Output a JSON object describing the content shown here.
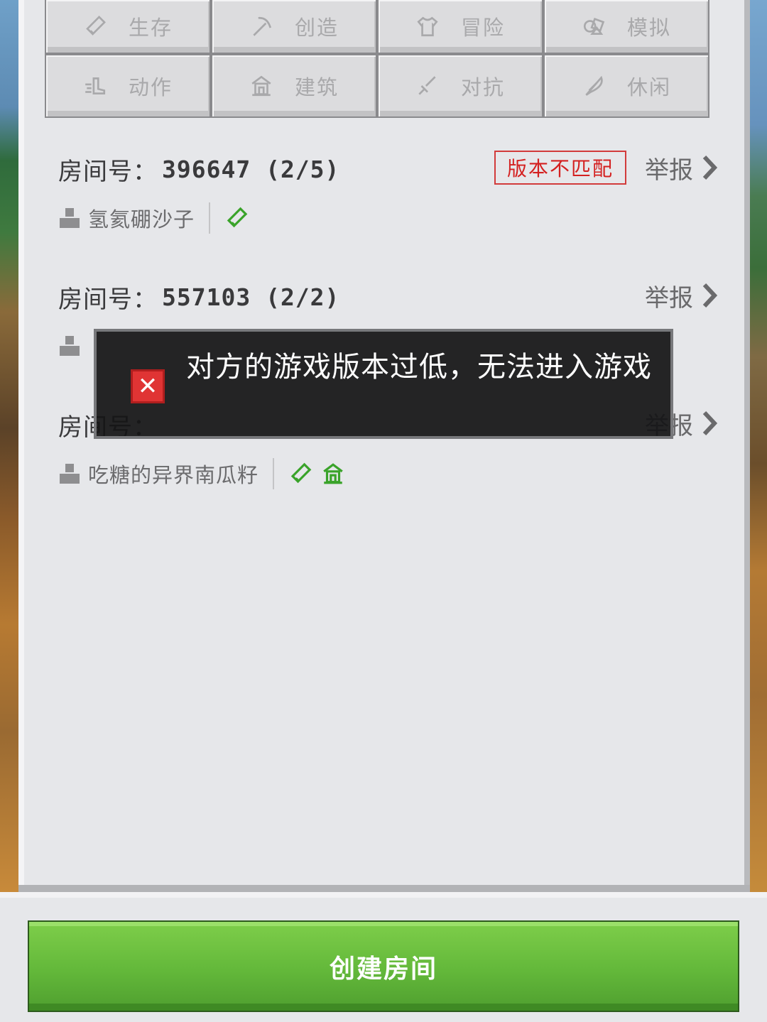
{
  "categories": [
    {
      "label": "生存",
      "icon": "pencil-icon"
    },
    {
      "label": "创造",
      "icon": "pickaxe-icon"
    },
    {
      "label": "冒险",
      "icon": "shirt-icon"
    },
    {
      "label": "模拟",
      "icon": "shapes-icon"
    },
    {
      "label": "动作",
      "icon": "boot-icon"
    },
    {
      "label": "建筑",
      "icon": "house-icon"
    },
    {
      "label": "对抗",
      "icon": "sword-icon"
    },
    {
      "label": "休闲",
      "icon": "feather-icon"
    }
  ],
  "rooms": [
    {
      "label": "房间号：",
      "number": "396647 (2/5)",
      "badge": "版本不匹配",
      "report": "举报",
      "owner": "氢氦硼沙子",
      "tags": [
        "pencil-icon"
      ]
    },
    {
      "label": "房间号：",
      "number": "557103 (2/2)",
      "report": "举报",
      "owner": "",
      "tags": []
    },
    {
      "label": "房间号：",
      "number": "",
      "report": "举报",
      "owner": "吃糖的异界南瓜籽",
      "tags": [
        "pencil-icon",
        "house-icon"
      ]
    }
  ],
  "toast": {
    "message": "对方的游戏版本过低，无法进入游戏",
    "icon": "error-close-icon"
  },
  "create_button": "创建房间",
  "colors": {
    "accent_green": "#63b83a",
    "tag_green": "#3aa32a",
    "badge_red": "#d42020"
  }
}
